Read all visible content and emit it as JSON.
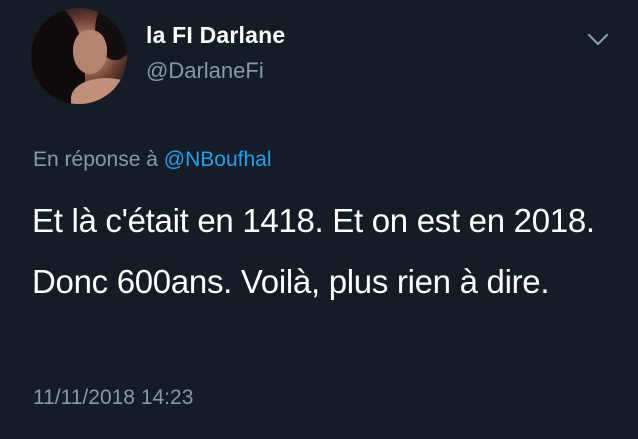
{
  "tweet": {
    "display_name": "la FI Darlane",
    "handle": "@DarlaneFi",
    "reply_prefix": "En réponse à",
    "reply_mention": "@NBoufhal",
    "text": "Et là c'était en 1418. Et on est en 2018. Donc 600ans. Voilà, plus rien à dire.",
    "timestamp": "11/11/2018 14:23",
    "avatar_icon": "profile-photo",
    "menu_icon": "chevron-down-icon"
  },
  "colors": {
    "background": "#141d26",
    "primary_text": "#ffffff",
    "secondary_text": "#8899a6",
    "mention": "#1da1f2"
  }
}
